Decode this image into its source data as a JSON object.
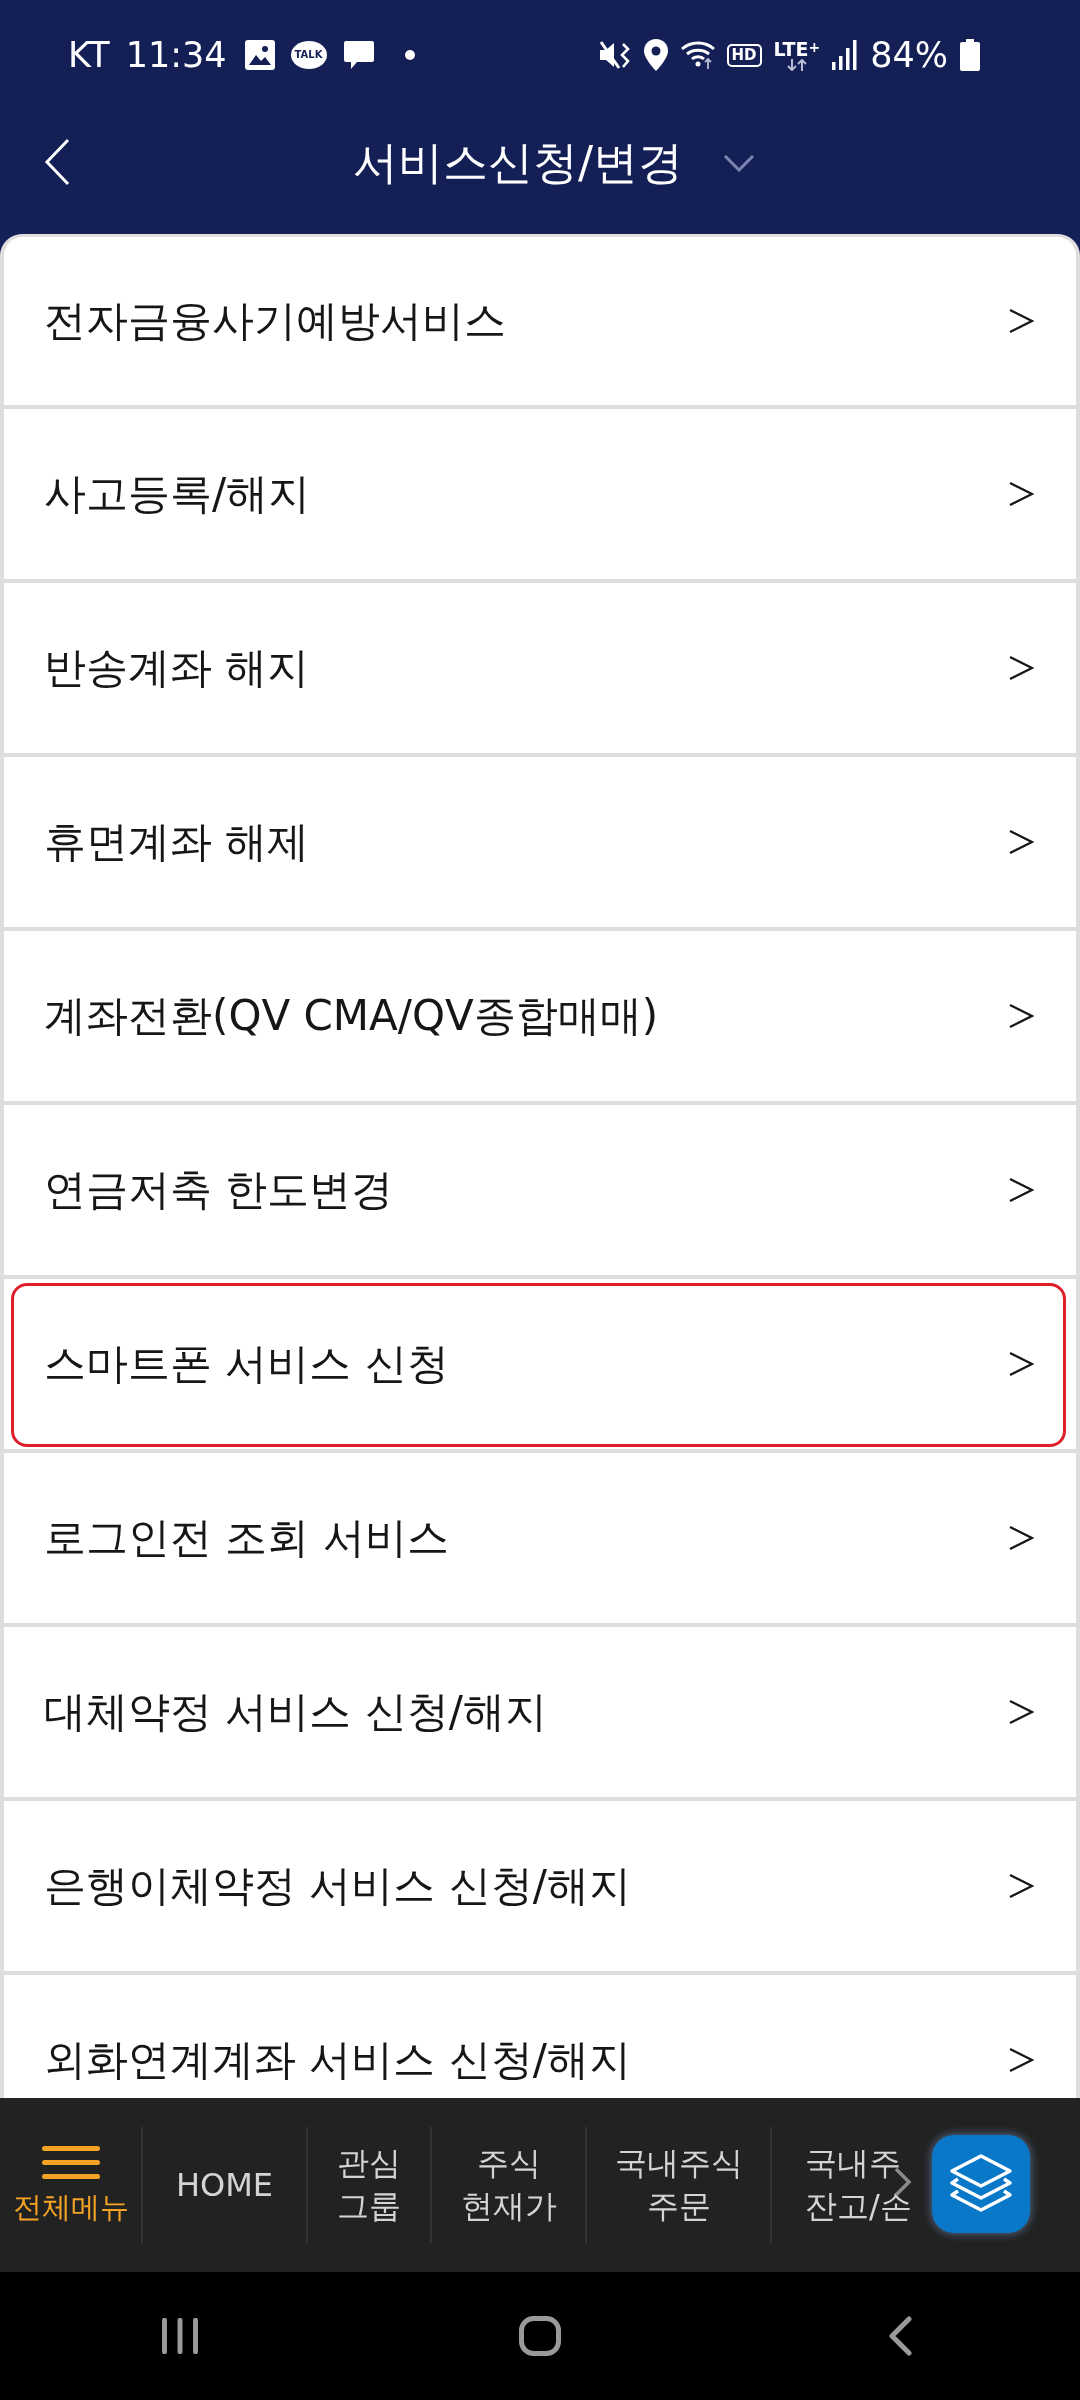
{
  "status_bar": {
    "carrier": "KT",
    "time": "11:34",
    "talk_label": "TALK",
    "hd_label": "HD",
    "network": "LTE$^{+}$",
    "battery": "84%"
  },
  "header": {
    "title": "서비스신청/변경"
  },
  "menu_items": [
    {
      "label": "전자금융사기예방서비스",
      "highlighted": false
    },
    {
      "label": "사고등록/해지",
      "highlighted": false
    },
    {
      "label": "반송계좌 해지",
      "highlighted": false
    },
    {
      "label": "휴면계좌 해제",
      "highlighted": false
    },
    {
      "label": "계좌전환(QV CMA/QV종합매매)",
      "highlighted": false
    },
    {
      "label": "연금저축 한도변경",
      "highlighted": false
    },
    {
      "label": "스마트폰 서비스 신청",
      "highlighted": true
    },
    {
      "label": "로그인전 조회 서비스",
      "highlighted": false
    },
    {
      "label": "대체약정 서비스 신청/해지",
      "highlighted": false
    },
    {
      "label": "은행이체약정 서비스 신청/해지",
      "highlighted": false
    },
    {
      "label": "외화연계계좌 서비스 신청/해지",
      "highlighted": false
    }
  ],
  "bottom_nav": {
    "items": [
      {
        "kind": "menu",
        "lines": [
          "전체메뉴"
        ]
      },
      {
        "kind": "link",
        "lines": [
          "HOME"
        ]
      },
      {
        "kind": "link",
        "lines": [
          "관심",
          "그룹"
        ]
      },
      {
        "kind": "link",
        "lines": [
          "주식",
          "현재가"
        ]
      },
      {
        "kind": "link",
        "lines": [
          "국내주식",
          "주문"
        ]
      },
      {
        "kind": "cut",
        "lines": [
          "국내주",
          "잔고/손"
        ]
      }
    ]
  }
}
